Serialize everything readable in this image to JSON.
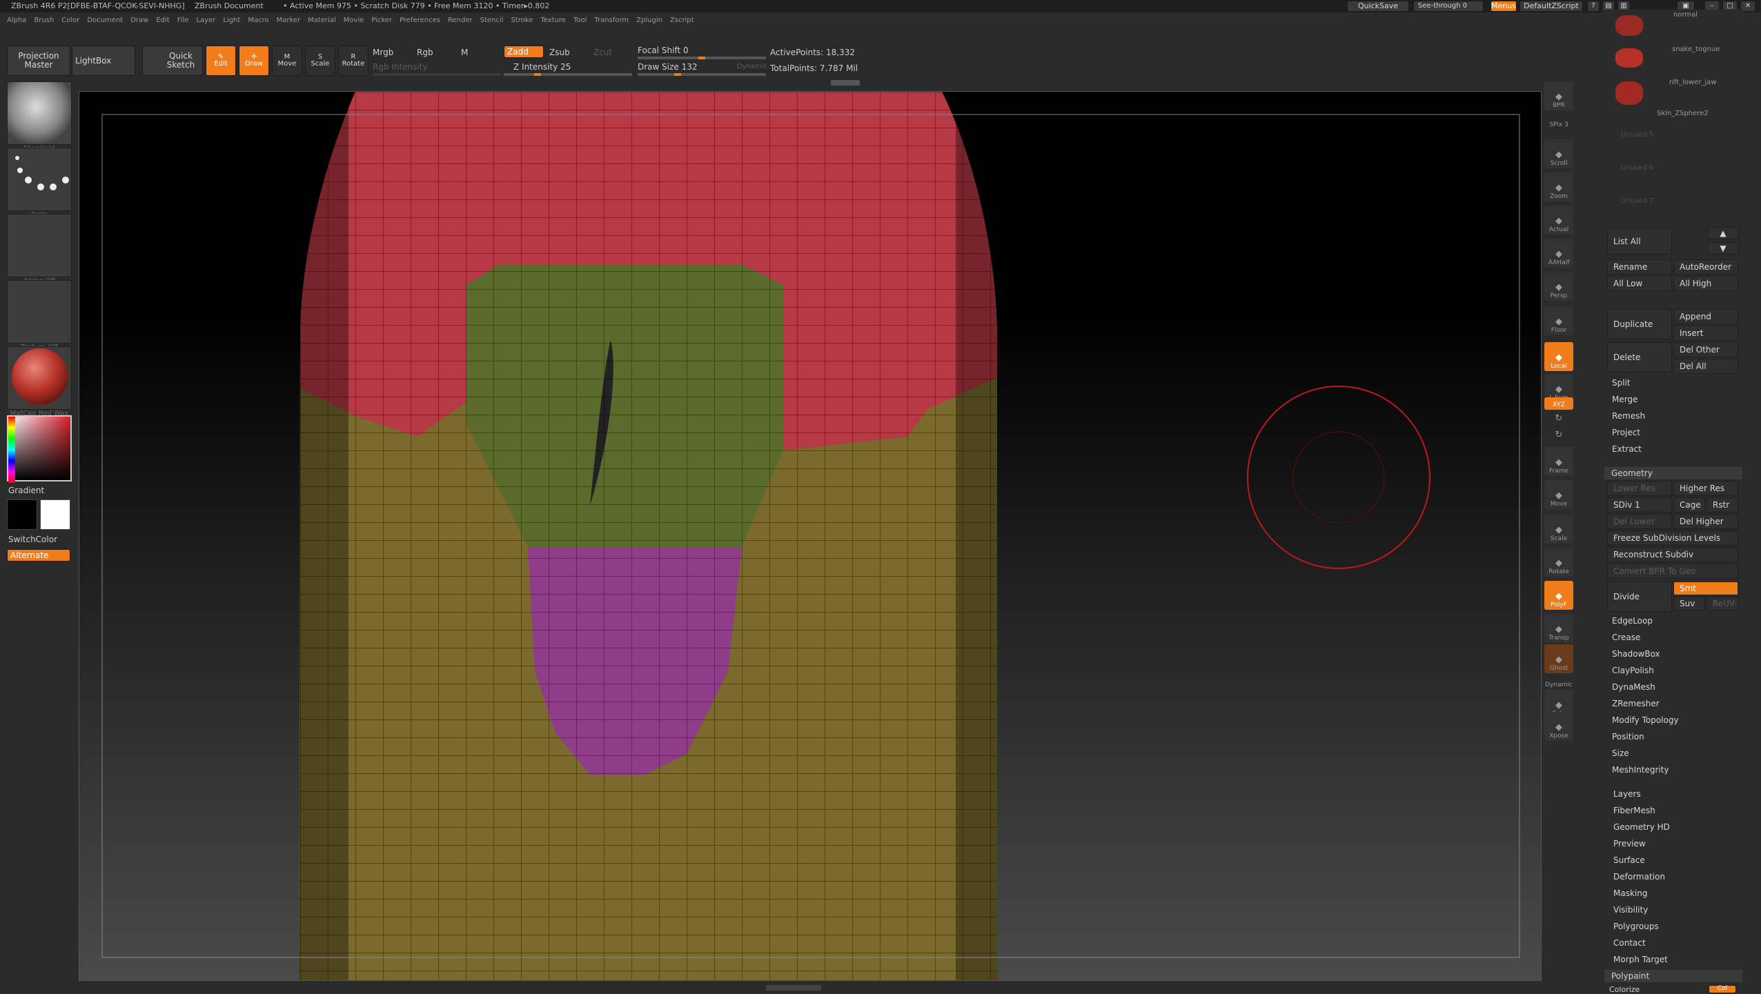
{
  "titlebar": {
    "app": "ZBrush 4R6 P2[DFBE-BTAF-QCOK-SEVI-NHHG]",
    "doc": "ZBrush Document",
    "stats": "• Active Mem 975 • Scratch Disk 779 • Free Mem 3120 • Timer▸0.802",
    "quicksave": "QuickSave",
    "seethrough": "See-through   0",
    "menus": "Menus",
    "script": "DefaultZScript"
  },
  "menubar": [
    "Alpha",
    "Brush",
    "Color",
    "Document",
    "Draw",
    "Edit",
    "File",
    "Layer",
    "Light",
    "Macro",
    "Marker",
    "Material",
    "Movie",
    "Picker",
    "Preferences",
    "Render",
    "Stencil",
    "Stroke",
    "Texture",
    "Tool",
    "Transform",
    "Zplugin",
    "Zscript"
  ],
  "toolbar": {
    "projection_master": "Projection Master",
    "lightbox": "LightBox",
    "quick_sketch": "Quick Sketch",
    "edit": "Edit",
    "draw": "Draw",
    "move": "Move",
    "scale": "Scale",
    "rotate": "Rotate",
    "mrgb": "Mrgb",
    "rgb": "Rgb",
    "m": "M",
    "zadd": "Zadd",
    "zsub": "Zsub",
    "zcut": "Zcut",
    "rgb_intensity": "Rgb Intensity",
    "z_intensity": "Z Intensity 25",
    "focal_shift": "Focal Shift 0",
    "draw_size": "Draw Size 132",
    "dynamic": "Dynamic",
    "active_points": "ActivePoints: 18,332",
    "total_points": "TotalPoints: 7.787 Mil",
    "z_intensity_value": 0.25,
    "focal_shift_value": 0.5,
    "draw_size_value": 0.3
  },
  "leftshelf": {
    "brush": "Standard",
    "stroke": "Dots",
    "alpha": "Alpha Off",
    "texture": "Texture Off",
    "material": "MatCap Red Wax",
    "gradient": "Gradient",
    "switchcolor": "SwitchColor",
    "alternate": "Alternate"
  },
  "rightshelf": [
    "BPR",
    "SPix 3",
    "Scroll",
    "Zoom",
    "Actual",
    "AAHalf",
    "Persp",
    "Floor",
    "Local",
    "L.Sym",
    "XYZ",
    "",
    "",
    "Frame",
    "Move",
    "Scale",
    "Rotate",
    "PolyF",
    "Transp",
    "Ghost",
    "Dynamic",
    "Solo",
    "Xpose"
  ],
  "subtools": {
    "items": [
      "normal",
      "snake_tognue",
      "rift_lower_jaw",
      "Skin_ZSphere2",
      "Unused 5",
      "Unused 6",
      "Unused 7"
    ],
    "list_all": "List All",
    "rename": "Rename",
    "autoreorder": "AutoReorder",
    "all_low": "All Low",
    "all_high": "All High",
    "duplicate": "Duplicate",
    "append": "Append",
    "insert": "Insert",
    "delete": "Delete",
    "del_other": "Del Other",
    "del_all": "Del All",
    "split": "Split",
    "merge": "Merge",
    "remesh": "Remesh",
    "project": "Project",
    "extract": "Extract"
  },
  "geometry": {
    "header": "Geometry",
    "lower_res": "Lower Res",
    "higher_res": "Higher Res",
    "sdiv": "SDiv 1",
    "cage": "Cage",
    "rstr": "Rstr",
    "del_lower": "Del Lower",
    "del_higher": "Del Higher",
    "freeze": "Freeze SubDivision Levels",
    "reconstruct": "Reconstruct Subdiv",
    "convert": "Convert BPR To Geo",
    "divide": "Divide",
    "smt": "Smt",
    "suv": "Suv",
    "reuv": "ReUV",
    "items": [
      "EdgeLoop",
      "Crease",
      "ShadowBox",
      "ClayPolish",
      "DynaMesh",
      "ZRemesher",
      "Modify Topology",
      "Position",
      "Size",
      "MeshIntegrity"
    ]
  },
  "tool_sections": [
    "Layers",
    "FiberMesh",
    "Geometry HD",
    "Preview",
    "Surface",
    "Deformation",
    "Masking",
    "Visibility",
    "Polygroups",
    "Contact",
    "Morph Target"
  ],
  "bottom": {
    "polypaint": "Polypaint",
    "colorize": "Colorize",
    "colorize_toggle": "Col"
  },
  "colors": {
    "accent": "#f07d1a",
    "panel": "#2b2b2b",
    "group_red": "#b23a44",
    "group_olive": "#6e6b2a",
    "group_purple": "#8c3f86",
    "group_green": "#566a2c"
  }
}
